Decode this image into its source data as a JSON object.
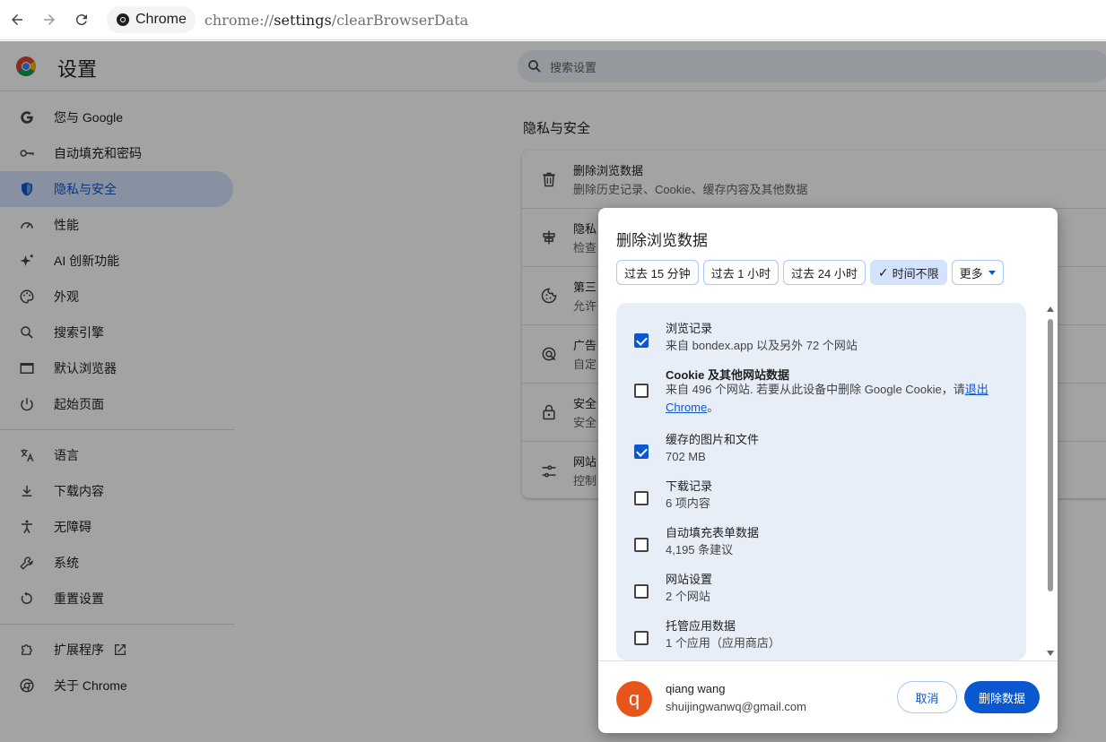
{
  "browser": {
    "chip_label": "Chrome",
    "url_scheme": "chrome://",
    "url_host": "settings",
    "url_path": "/clearBrowserData"
  },
  "header": {
    "title": "设置",
    "search_placeholder": "搜索设置"
  },
  "sidebar": {
    "items": [
      {
        "label": "您与 Google",
        "icon": "google-icon"
      },
      {
        "label": "自动填充和密码",
        "icon": "key-icon"
      },
      {
        "label": "隐私与安全",
        "icon": "shield-icon",
        "active": true
      },
      {
        "label": "性能",
        "icon": "speedometer-icon"
      },
      {
        "label": "AI 创新功能",
        "icon": "sparkle-icon"
      },
      {
        "label": "外观",
        "icon": "palette-icon"
      },
      {
        "label": "搜索引擎",
        "icon": "search-icon"
      },
      {
        "label": "默认浏览器",
        "icon": "browser-window-icon"
      },
      {
        "label": "起始页面",
        "icon": "power-icon"
      },
      {
        "label": "语言",
        "icon": "translate-icon"
      },
      {
        "label": "下载内容",
        "icon": "download-icon"
      },
      {
        "label": "无障碍",
        "icon": "accessibility-icon"
      },
      {
        "label": "系统",
        "icon": "wrench-icon"
      },
      {
        "label": "重置设置",
        "icon": "reset-icon"
      },
      {
        "label": "扩展程序",
        "icon": "puzzle-icon"
      },
      {
        "label": "关于 Chrome",
        "icon": "chrome-icon"
      }
    ]
  },
  "main": {
    "section_title": "隐私与安全",
    "rows": [
      {
        "title": "删除浏览数据",
        "subtitle": "删除历史记录、Cookie、缓存内容及其他数据",
        "icon": "trash-icon"
      },
      {
        "title": "隐私",
        "subtitle": "检查",
        "icon": "guide-icon"
      },
      {
        "title": "第三",
        "subtitle": "允许",
        "icon": "cookie-icon"
      },
      {
        "title": "广告",
        "subtitle": "自定",
        "icon": "ads-icon"
      },
      {
        "title": "安全",
        "subtitle": "安全",
        "icon": "lock-icon"
      },
      {
        "title": "网站",
        "subtitle": "控制",
        "icon": "tune-icon"
      }
    ]
  },
  "dialog": {
    "title": "删除浏览数据",
    "time_ranges": [
      {
        "label": "过去 15 分钟",
        "selected": false
      },
      {
        "label": "过去 1 小时",
        "selected": false
      },
      {
        "label": "过去 24 小时",
        "selected": false
      },
      {
        "label": "时间不限",
        "selected": true
      },
      {
        "label": "更多",
        "selected": false
      }
    ],
    "items": [
      {
        "title": "浏览记录",
        "subtitle": "来自 bondex.app 以及另外 72 个网站",
        "checked": true
      },
      {
        "title": "Cookie 及其他网站数据",
        "subtitle": "来自 496 个网站. 若要从此设备中删除 Google Cookie，请",
        "link": "退出 Chrome",
        "suffix": "。",
        "checked": false
      },
      {
        "title": "缓存的图片和文件",
        "subtitle": "702 MB",
        "checked": true
      },
      {
        "title": "下载记录",
        "subtitle": "6 项内容",
        "checked": false
      },
      {
        "title": "自动填充表单数据",
        "subtitle": "4,195 条建议",
        "checked": false
      },
      {
        "title": "网站设置",
        "subtitle": "2 个网站",
        "checked": false
      },
      {
        "title": "托管应用数据",
        "subtitle": "1 个应用（应用商店）",
        "checked": false
      }
    ],
    "account": {
      "initial": "q",
      "name": "qiang wang",
      "email": "shuijingwanwq@gmail.com"
    },
    "cancel_label": "取消",
    "delete_label": "删除数据"
  },
  "colors": {
    "accent": "#0b57d0",
    "avatar": "#e8551b",
    "active_bg": "#d3e3fd"
  }
}
